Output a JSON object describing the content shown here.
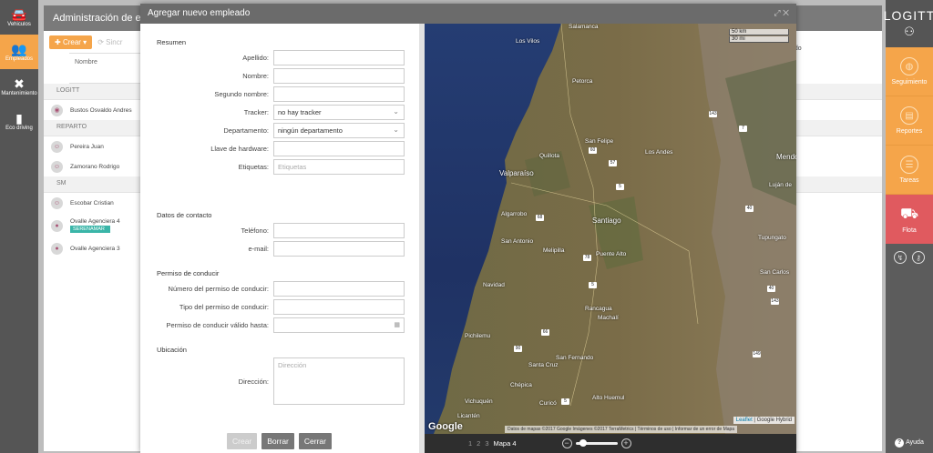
{
  "left_nav": {
    "items": [
      {
        "label": "Vehiculos",
        "icon": "car-icon",
        "active": false
      },
      {
        "label": "Empleados",
        "icon": "people-icon",
        "active": true
      },
      {
        "label": "Mantenimiento",
        "icon": "wrench-icon",
        "active": false
      },
      {
        "label": "Eco driving",
        "icon": "chart-icon",
        "active": false
      }
    ]
  },
  "right_nav": {
    "logo": "LOGITT",
    "items": [
      {
        "label": "Seguimiento",
        "icon": "globe-icon"
      },
      {
        "label": "Reportes",
        "icon": "report-icon"
      },
      {
        "label": "Tareas",
        "icon": "tasks-icon"
      },
      {
        "label": "Flota",
        "icon": "fleet-icon"
      }
    ],
    "help": "Ayuda",
    "colors": {
      "orange": "#f5a54a",
      "red": "#e05a5f"
    }
  },
  "background": {
    "title": "Administración de em",
    "create_button": "Crear",
    "sync_button": "Sincr",
    "column_header": "Nombre",
    "right_label": "ado",
    "groups": [
      {
        "name": "LOGITT",
        "rows": [
          {
            "name": "Bustos Osvaldo Andres",
            "badge": ""
          }
        ]
      },
      {
        "name": "REPARTO",
        "rows": [
          {
            "name": "Pereira Juan",
            "badge": ""
          },
          {
            "name": "Zamorano Rodrigo",
            "badge": ""
          }
        ]
      },
      {
        "name": "SM",
        "rows": [
          {
            "name": "Escobar Cristian",
            "badge": ""
          },
          {
            "name": "Ovalle Agenciera 4",
            "badge": "SERENAMAR"
          },
          {
            "name": "Ovalle Agenciera 3",
            "badge": ""
          }
        ]
      }
    ]
  },
  "modal": {
    "title": "Agregar nuevo empleado",
    "sections": {
      "resumen": "Resumen",
      "contacto": "Datos de contacto",
      "permiso": "Permiso de conducir",
      "ubicacion": "Ubicación"
    },
    "fields": {
      "apellido": {
        "label": "Apellido:",
        "value": ""
      },
      "nombre": {
        "label": "Nombre:",
        "value": ""
      },
      "segundo": {
        "label": "Segundo nombre:",
        "value": ""
      },
      "tracker": {
        "label": "Tracker:",
        "value": "no hay tracker"
      },
      "departamento": {
        "label": "Departamento:",
        "value": "ningún departamento"
      },
      "llave": {
        "label": "Llave de hardware:",
        "value": ""
      },
      "etiquetas": {
        "label": "Etiquetas:",
        "placeholder": "Etiquetas"
      },
      "telefono": {
        "label": "Teléfono:",
        "value": ""
      },
      "email": {
        "label": "e-mail:",
        "value": ""
      },
      "num_permiso": {
        "label": "Número del permiso de conducir:",
        "value": ""
      },
      "tipo_permiso": {
        "label": "Tipo del permiso de conducir:",
        "value": ""
      },
      "valido": {
        "label": "Permiso de conducir válido hasta:",
        "value": ""
      },
      "direccion": {
        "label": "Dirección:",
        "placeholder": "Dirección"
      }
    },
    "buttons": {
      "crear": "Crear",
      "borrar": "Borrar",
      "cerrar": "Cerrar"
    }
  },
  "map": {
    "scale": [
      "50 km",
      "30 mi"
    ],
    "labels": {
      "salamanca": "Salamanca",
      "los_vilos": "Los Vilos",
      "petorca": "Petorca",
      "quillota": "Quillota",
      "san_felipe": "San Felipe",
      "los_andes": "Los Andes",
      "valparaiso": "Valparaíso",
      "algarrobo": "Algarrobo",
      "santiago": "Santiago",
      "san_antonio": "San Antonio",
      "melipilla": "Melipilla",
      "puente_alto": "Puente Alto",
      "navidad": "Navidad",
      "rancagua": "Rancagua",
      "machali": "Machalí",
      "pichilemu": "Pichilemu",
      "san_fernando": "San Fernando",
      "santa_cruz": "Santa Cruz",
      "chepica": "Chépica",
      "curico": "Curicó",
      "alto_huemul": "Alto Huemul",
      "licanten": "Licantén",
      "vichuquen": "Vichuquén",
      "mendoza": "Mendo",
      "lujan": "Luján de",
      "tupungato": "Tupungato",
      "san_carlos": "San Carlos"
    },
    "highways": [
      "5",
      "60",
      "57",
      "7",
      "68",
      "78",
      "5",
      "66",
      "90",
      "5",
      "143",
      "40",
      "40",
      "149",
      "143"
    ],
    "google": "Google",
    "attribution": "Datos de mapas ©2017 Google Imágenes ©2017 TerraMetrics | Términos de uso | Informar de un error de Mapa",
    "leaflet": "Leaflet",
    "hybrid": "| Google Hybrid"
  },
  "map_footer": {
    "pages": [
      "1",
      "2",
      "3"
    ],
    "current": "Mapa 4",
    "zoom": 0.15
  }
}
